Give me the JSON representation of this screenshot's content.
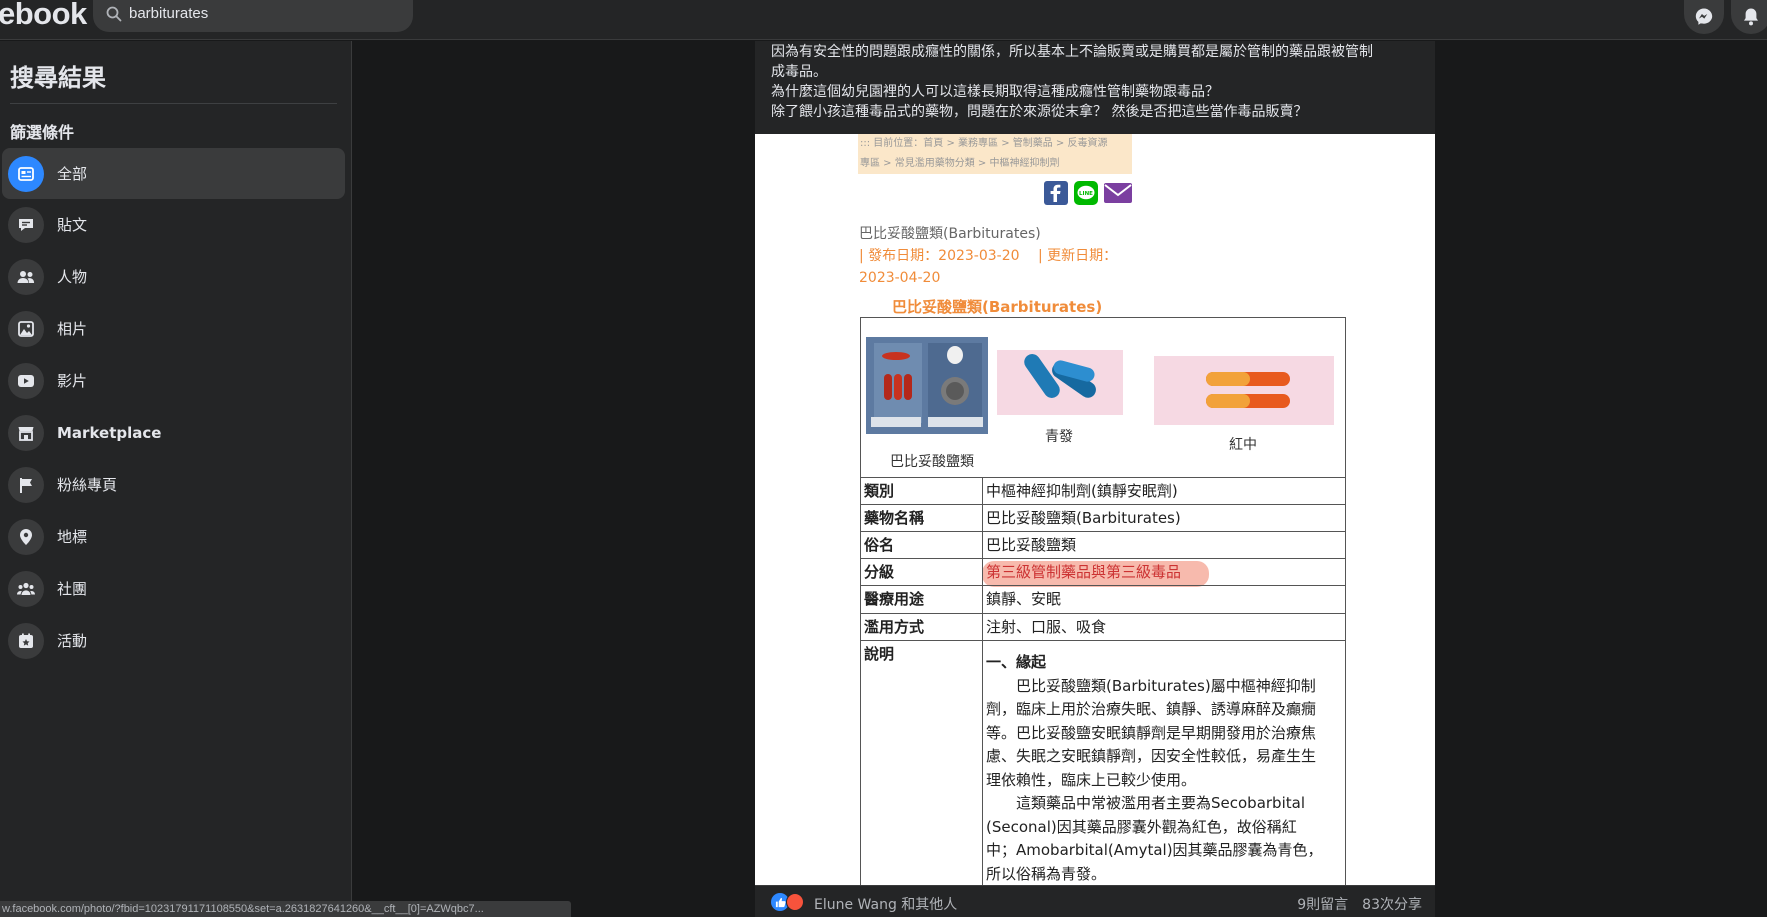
{
  "header": {
    "logo_text": "ebook",
    "search_value": "barbiturates"
  },
  "sidebar": {
    "title": "搜尋結果",
    "filter_title": "篩選條件",
    "items": [
      {
        "label": "全部",
        "icon": "feed-icon"
      },
      {
        "label": "貼文",
        "icon": "post-icon"
      },
      {
        "label": "人物",
        "icon": "people-icon"
      },
      {
        "label": "相片",
        "icon": "photo-icon"
      },
      {
        "label": "影片",
        "icon": "video-icon"
      },
      {
        "label": "Marketplace",
        "icon": "marketplace-icon"
      },
      {
        "label": "粉絲專頁",
        "icon": "flag-icon"
      },
      {
        "label": "地標",
        "icon": "location-icon"
      },
      {
        "label": "社團",
        "icon": "groups-icon"
      },
      {
        "label": "活動",
        "icon": "event-icon"
      }
    ]
  },
  "status_url": "w.facebook.com/photo/?fbid=10231791171108550&set=a.2631827641260&__cft__[0]=AZWqbc7...",
  "post": {
    "lines": [
      "因為有安全性的問題跟成癮性的關係，所以基本上不論販賣或是購買都是屬於管制的藥品跟被管制",
      "成毒品。",
      "為什麼這個幼兒園裡的人可以這樣長期取得這種成癮性管制藥物跟毒品？",
      "除了餵小孩這種毒品式的藥物，問題在於來源從末拿？ 然後是否把這些當作毒品販賣？"
    ]
  },
  "photo": {
    "breadcrumb_1": "::: 目前位置：首頁 > 業務專區 > 管制藥品 > 反毒資源",
    "breadcrumb_2": "專區 > 常見濫用藥物分類 > 中樞神經抑制劑",
    "doc_title": "巴比妥酸鹽類(Barbiturates)",
    "dates_1": "| 發布日期：2023-03-20 　| 更新日期：",
    "dates_2": "2023-04-20",
    "heading": "巴比妥酸鹽類(Barbiturates)",
    "captions": [
      "巴比妥酸鹽類",
      "青發",
      "紅中"
    ],
    "table": [
      {
        "key": "類別",
        "value": "中樞神經抑制劑(鎮靜安眠劑)"
      },
      {
        "key": "藥物名稱",
        "value": "巴比妥酸鹽類(Barbiturates)"
      },
      {
        "key": "俗名",
        "value": "巴比妥酸鹽類"
      },
      {
        "key": "分級",
        "value": "第三級管制藥品與第三級毒品"
      },
      {
        "key": "醫療用途",
        "value": "鎮靜、安眠"
      },
      {
        "key": "濫用方式",
        "value": "注射、口服、吸食"
      }
    ],
    "desc_key": "說明",
    "desc_heading": "一、緣起",
    "desc_lines": [
      "　　巴比妥酸鹽類(Barbiturates)屬中樞神經抑制",
      "劑，臨床上用於治療失眠、鎮靜、誘導麻醉及癲癇",
      "等。巴比妥酸鹽安眠鎮靜劑是早期開發用於治療焦",
      "慮、失眠之安眠鎮靜劑，因安全性較低，易產生生",
      "理依賴性，臨床上已較少使用。",
      "　　這類藥品中常被濫用者主要為Secobarbital",
      "(Seconal)因其藥品膠囊外觀為紅色，故俗稱紅",
      "中；Amobarbital(Amytal)因其藥品膠囊為青色，",
      "所以俗稱為青發。"
    ]
  },
  "footer": {
    "reacted_by": "Elune Wang 和其他人",
    "counts": "9則留言　83次分享"
  }
}
